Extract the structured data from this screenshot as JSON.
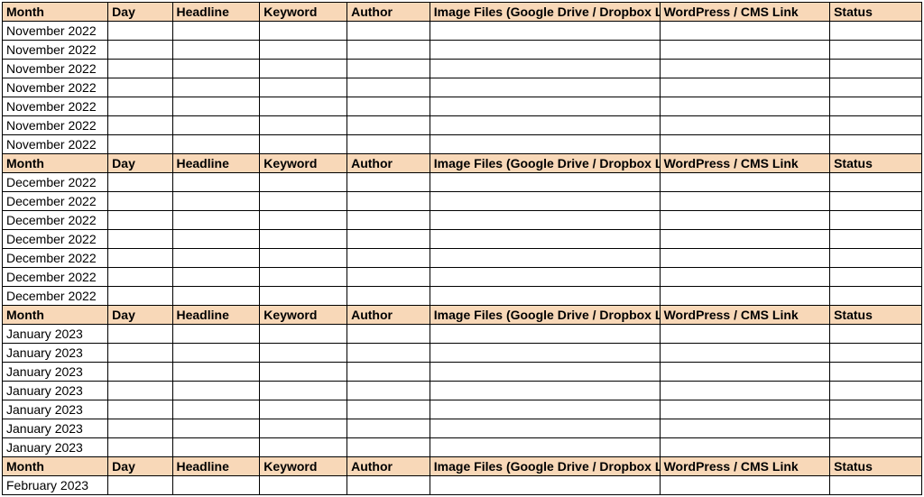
{
  "headers": {
    "month": "Month",
    "day": "Day",
    "headline": "Headline",
    "keyword": "Keyword",
    "author": "Author",
    "image": "Image Files (Google Drive / Dropbox Link)",
    "wordpress": "WordPress / CMS Link",
    "status": "Status"
  },
  "sections": [
    {
      "rows": [
        {
          "month": "November 2022"
        },
        {
          "month": "November 2022"
        },
        {
          "month": "November 2022"
        },
        {
          "month": "November 2022"
        },
        {
          "month": "November 2022"
        },
        {
          "month": "November 2022"
        },
        {
          "month": "November 2022"
        }
      ]
    },
    {
      "rows": [
        {
          "month": "December 2022"
        },
        {
          "month": "December 2022"
        },
        {
          "month": "December 2022"
        },
        {
          "month": "December 2022"
        },
        {
          "month": "December 2022"
        },
        {
          "month": "December 2022"
        },
        {
          "month": "December 2022"
        }
      ]
    },
    {
      "rows": [
        {
          "month": "January 2023"
        },
        {
          "month": "January 2023"
        },
        {
          "month": "January 2023"
        },
        {
          "month": "January 2023"
        },
        {
          "month": "January 2023"
        },
        {
          "month": "January 2023"
        },
        {
          "month": "January 2023"
        }
      ]
    },
    {
      "rows": [
        {
          "month": "February 2023"
        }
      ]
    }
  ]
}
